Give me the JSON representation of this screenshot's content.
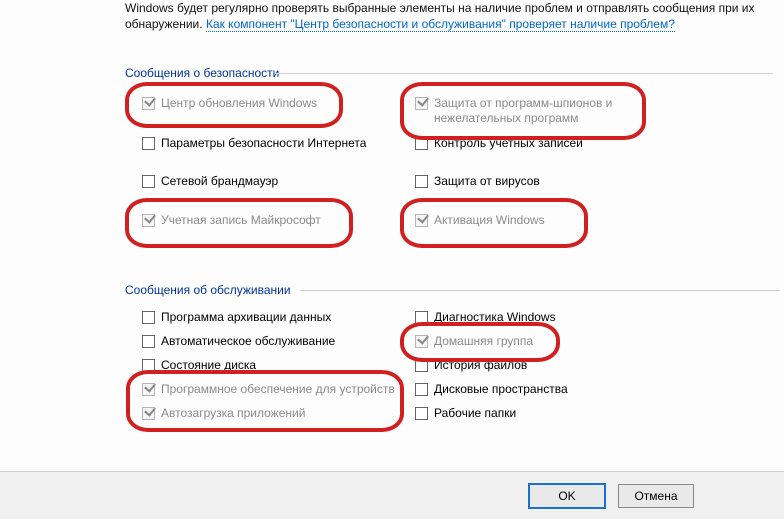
{
  "intro": {
    "text_a": "Windows будет регулярно проверять выбранные элементы на наличие проблем и отправлять сообщения при их обнаружении. ",
    "link": "Как компонент \"Центр безопасности и обслуживания\" проверяет наличие проблем?"
  },
  "sections": {
    "security_title": "Сообщения о безопасности",
    "maintenance_title": "Сообщения об обслуживании"
  },
  "security": {
    "windows_update": "Центр обновления Windows",
    "spyware": "Защита от программ-шпионов и нежелательных программ",
    "internet_security": "Параметры безопасности Интернета",
    "uac": "Контроль учетных записей",
    "firewall": "Сетевой брандмауэр",
    "virus": "Защита от вирусов",
    "ms_account": "Учетная запись Майкрософт",
    "activation": "Активация Windows"
  },
  "maintenance": {
    "backup": "Программа архивации данных",
    "diag": "Диагностика Windows",
    "auto_maint": "Автоматическое обслуживание",
    "homegroup": "Домашняя группа",
    "disk": "Состояние диска",
    "file_history": "История файлов",
    "device_sw": "Программное обеспечение для устройств",
    "storage_spaces": "Дисковые пространства",
    "startup_apps": "Автозагрузка приложений",
    "work_folders": "Рабочие папки"
  },
  "buttons": {
    "ok": "OK",
    "cancel": "Отмена"
  }
}
